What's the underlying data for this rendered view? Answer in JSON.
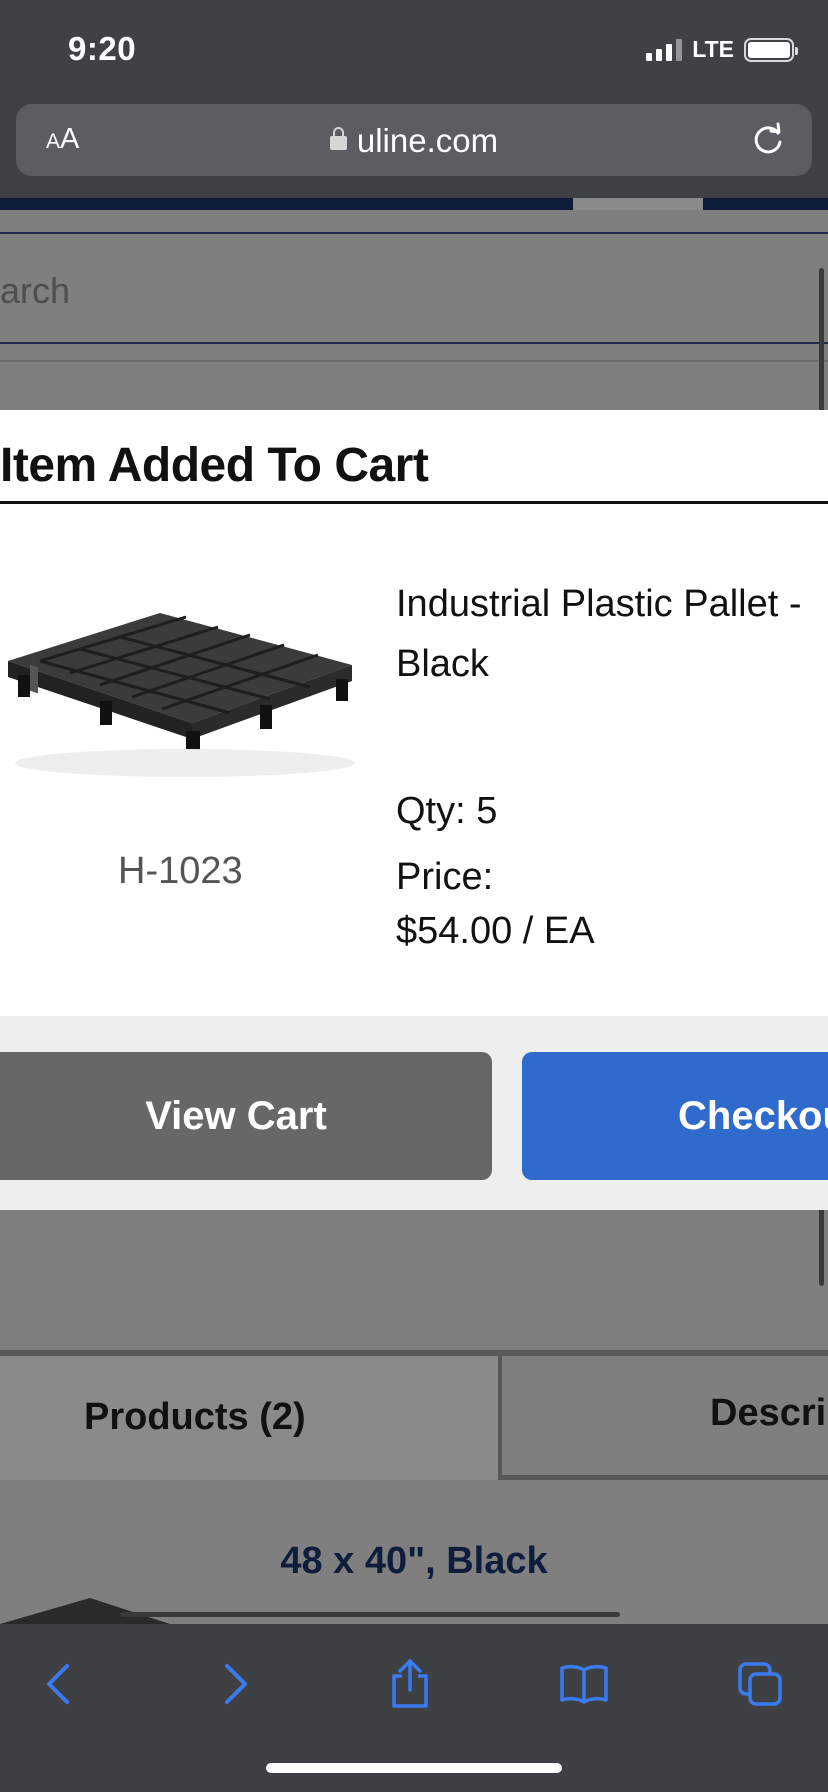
{
  "status_bar": {
    "time": "9:20",
    "network": "LTE"
  },
  "browser": {
    "text_size_small": "A",
    "text_size_large": "A",
    "url": "uline.com"
  },
  "page": {
    "search_placeholder_partial": "arch",
    "tabs": [
      {
        "label": "Products (2)"
      },
      {
        "label": "Descri"
      }
    ],
    "variant_label": "48 x 40\", Black"
  },
  "modal": {
    "title": "Item Added To Cart",
    "product": {
      "name_line1": "Industrial Plastic Pallet -",
      "name_line2": "Black",
      "sku": "H-1023",
      "qty": "Qty: 5",
      "price_label": "Price:",
      "price_value": "$54.00 / EA"
    },
    "buttons": {
      "view_cart": "View Cart",
      "checkout": "Checkout"
    },
    "colors": {
      "checkout": "#2f6acd",
      "view_cart": "#676767"
    }
  },
  "toolbar": {
    "icons": [
      "back-icon",
      "forward-icon",
      "share-icon",
      "bookmarks-icon",
      "tabs-icon"
    ]
  }
}
